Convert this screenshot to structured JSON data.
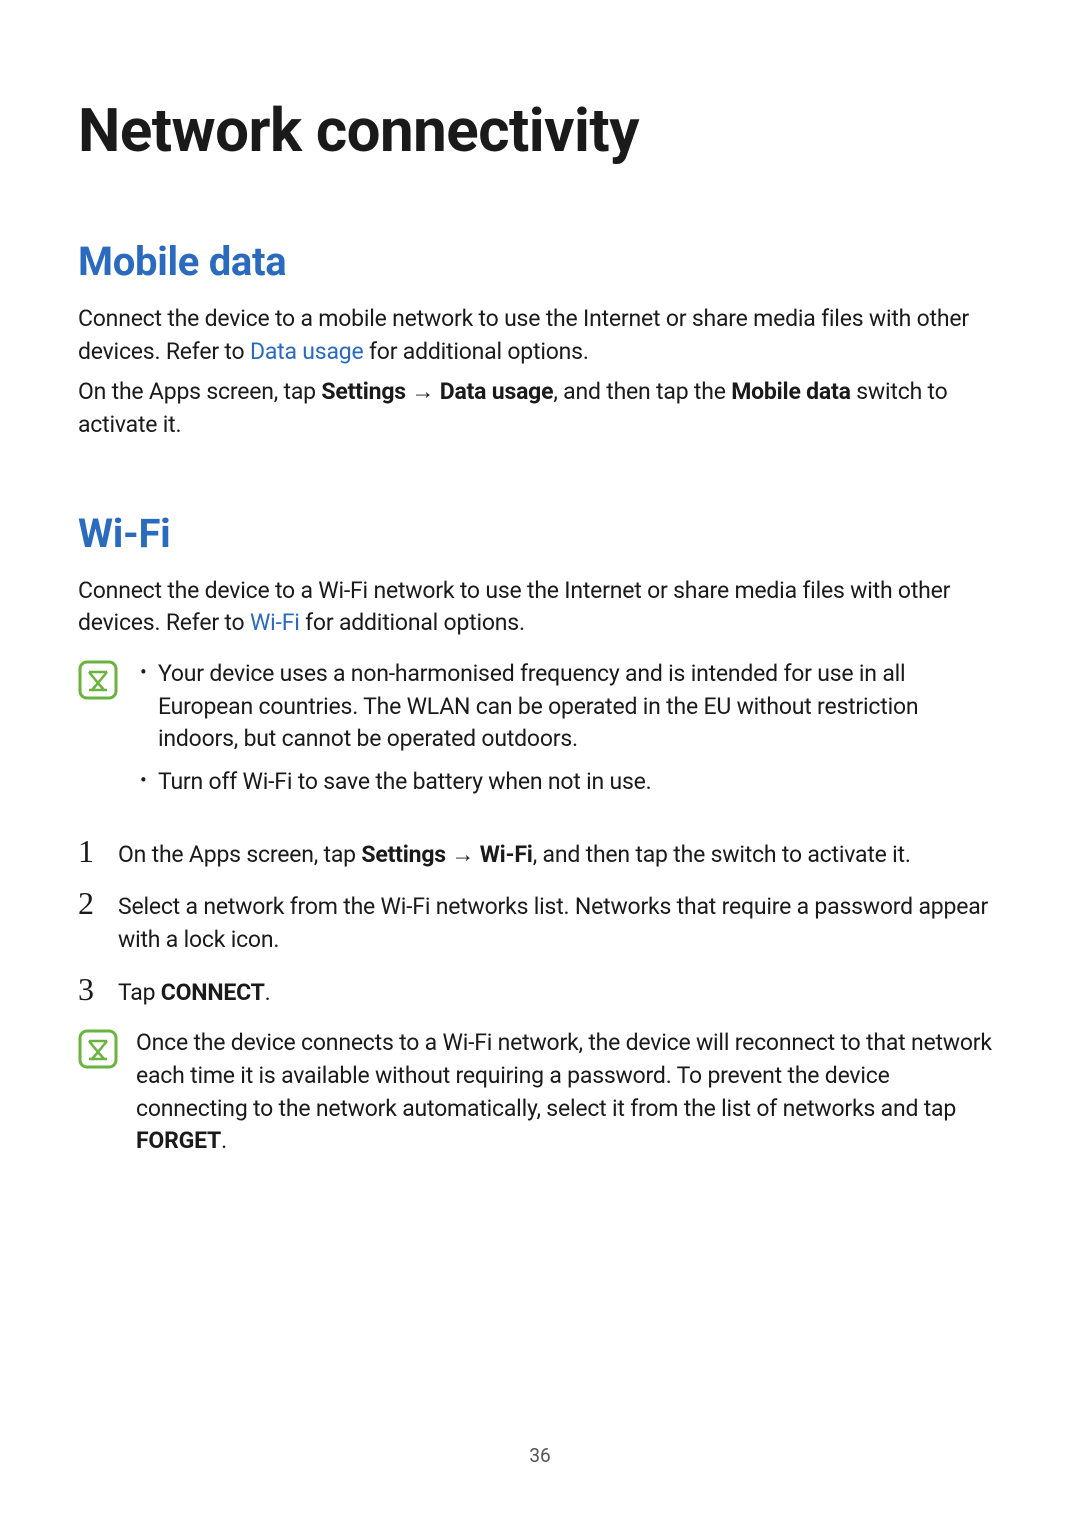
{
  "title": "Network connectivity",
  "sections": {
    "mobile_data": {
      "heading": "Mobile data",
      "intro_part1": "Connect the device to a mobile network to use the Internet or share media files with other devices. Refer to ",
      "intro_link": "Data usage",
      "intro_part2": " for additional options.",
      "instruction_part1": "On the Apps screen, tap ",
      "instruction_bold1": "Settings",
      "instruction_arrow": " → ",
      "instruction_bold2": "Data usage",
      "instruction_part2": ", and then tap the ",
      "instruction_bold3": "Mobile data",
      "instruction_part3": " switch to activate it."
    },
    "wifi": {
      "heading": "Wi-Fi",
      "intro_part1": "Connect the device to a Wi-Fi network to use the Internet or share media files with other devices. Refer to ",
      "intro_link": "Wi-Fi",
      "intro_part2": " for additional options.",
      "note1_bullet1": "Your device uses a non-harmonised frequency and is intended for use in all European countries. The WLAN can be operated in the EU without restriction indoors, but cannot be operated outdoors.",
      "note1_bullet2": "Turn off Wi-Fi to save the battery when not in use.",
      "steps": {
        "s1_num": "1",
        "s1_part1": "On the Apps screen, tap ",
        "s1_bold1": "Settings",
        "s1_arrow": " → ",
        "s1_bold2": "Wi-Fi",
        "s1_part2": ", and then tap the switch to activate it.",
        "s2_num": "2",
        "s2_text": "Select a network from the Wi-Fi networks list. Networks that require a password appear with a lock icon.",
        "s3_num": "3",
        "s3_part1": "Tap ",
        "s3_bold": "CONNECT",
        "s3_part2": "."
      },
      "note2_part1": "Once the device connects to a Wi-Fi network, the device will reconnect to that network each time it is available without requiring a password. To prevent the device connecting to the network automatically, select it from the list of networks and tap ",
      "note2_bold": "FORGET",
      "note2_part2": "."
    }
  },
  "page_number": "36"
}
